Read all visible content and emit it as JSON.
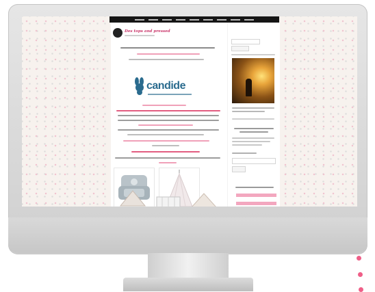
{
  "blog": {
    "title": "Des tops and pressed"
  },
  "sidebar": {
    "ad_brand": "candide"
  },
  "colors": {
    "accent": "#ef5f88",
    "nav": "#151515",
    "brand": "#2a6b8e"
  }
}
